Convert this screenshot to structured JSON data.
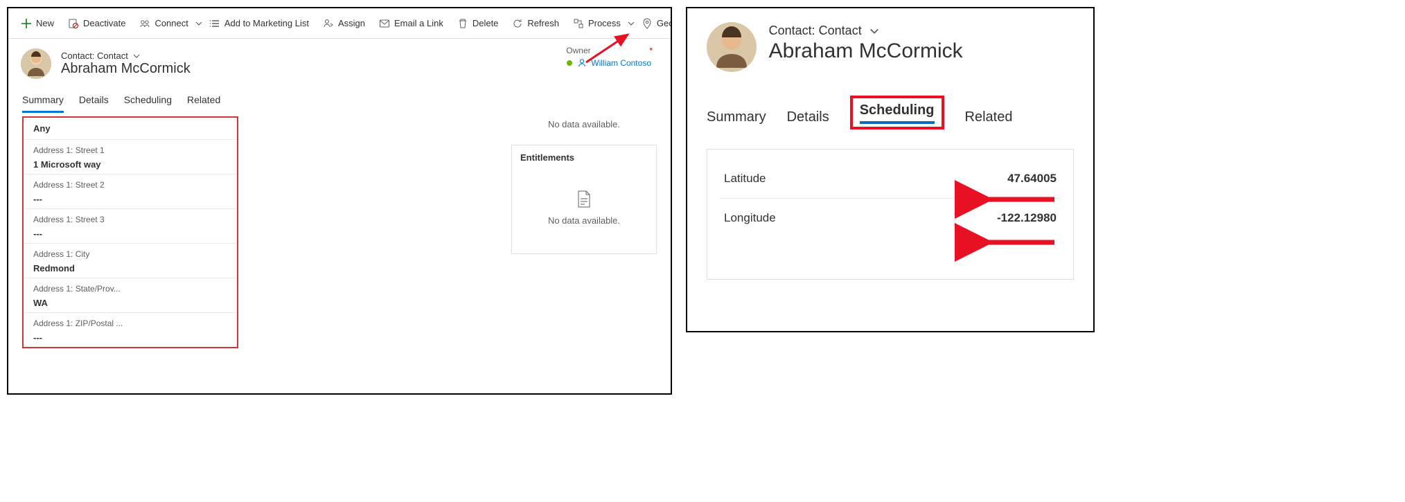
{
  "left": {
    "commands": {
      "new": "New",
      "deactivate": "Deactivate",
      "connect": "Connect",
      "addToMarketing": "Add to Marketing List",
      "assign": "Assign",
      "emailLink": "Email a Link",
      "delete": "Delete",
      "refresh": "Refresh",
      "process": "Process",
      "geoCode": "Geo Code"
    },
    "breadcrumb": "Contact: Contact",
    "recordName": "Abraham McCormick",
    "owner": {
      "label": "Owner",
      "value": "William Contoso"
    },
    "tabs": {
      "summary": "Summary",
      "details": "Details",
      "scheduling": "Scheduling",
      "related": "Related"
    },
    "side": {
      "noData": "No data available.",
      "entitlements": "Entitlements",
      "noData2": "No data available."
    },
    "form": {
      "head": "Any",
      "rows": [
        {
          "label": "Address 1: Street 1",
          "value": "1 Microsoft way"
        },
        {
          "label": "Address 1: Street 2",
          "value": "---"
        },
        {
          "label": "Address 1: Street 3",
          "value": "---"
        },
        {
          "label": "Address 1: City",
          "value": "Redmond"
        },
        {
          "label": "Address 1: State/Prov...",
          "value": "WA"
        },
        {
          "label": "Address 1: ZIP/Postal ...",
          "value": "---"
        }
      ]
    }
  },
  "right": {
    "breadcrumb": "Contact: Contact",
    "recordName": "Abraham McCormick",
    "tabs": {
      "summary": "Summary",
      "details": "Details",
      "scheduling": "Scheduling",
      "related": "Related"
    },
    "coords": {
      "latLabel": "Latitude",
      "latValue": "47.64005",
      "lonLabel": "Longitude",
      "lonValue": "-122.12980"
    }
  }
}
